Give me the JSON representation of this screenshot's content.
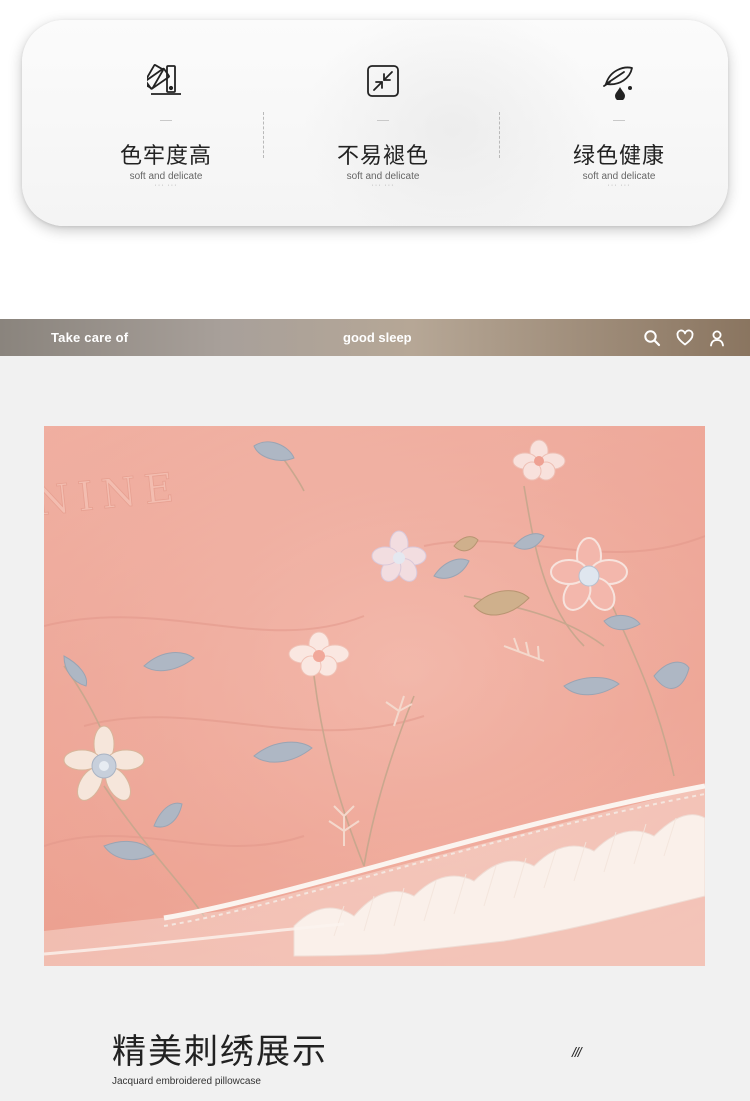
{
  "features": [
    {
      "icon": "color-swatch-icon",
      "title": "色牢度高",
      "subtitle": "soft and delicate",
      "dots": "··· ···"
    },
    {
      "icon": "shrink-arrows-icon",
      "title": "不易褪色",
      "subtitle": "soft and delicate",
      "dots": "··· ···"
    },
    {
      "icon": "leaf-drop-icon",
      "title": "绿色健康",
      "subtitle": "soft and delicate",
      "dots": "··· ···"
    }
  ],
  "banner": {
    "left_text": "Take care of",
    "center_text": "good sleep",
    "icons": [
      "search-icon",
      "heart-icon",
      "user-icon"
    ]
  },
  "photo": {
    "embroidered_text": "NINE",
    "colors": {
      "fabric": "#efaa9b",
      "lace": "#fbf4ef",
      "embroidery_grey": "#aeb7c4"
    }
  },
  "caption": {
    "title": "精美刺绣展示",
    "subtitle": "Jacquard embroidered pillowcase",
    "slashes": "///"
  }
}
